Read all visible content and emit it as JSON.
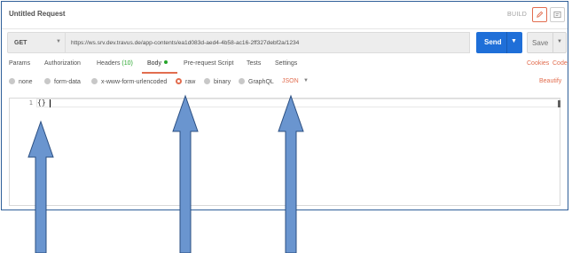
{
  "title": "Untitled Request",
  "build_label": "BUILD",
  "request": {
    "method": "GET",
    "url": "https://ws.srv.dev.travus.de/app-contents/ea1d083d-aed4-4b58-ac16-2ff327debf2a/1234",
    "send_label": "Send",
    "save_label": "Save"
  },
  "tabs": [
    {
      "label": "Params"
    },
    {
      "label": "Authorization"
    },
    {
      "label": "Headers",
      "count": "(10)"
    },
    {
      "label": "Body",
      "active": true
    },
    {
      "label": "Pre-request Script"
    },
    {
      "label": "Tests"
    },
    {
      "label": "Settings"
    }
  ],
  "tab_links": {
    "cookies": "Cookies",
    "code": "Code"
  },
  "body_modes": [
    {
      "label": "none"
    },
    {
      "label": "form-data"
    },
    {
      "label": "x-www-form-urlencoded"
    },
    {
      "label": "raw",
      "selected": true
    },
    {
      "label": "binary"
    },
    {
      "label": "GraphQL"
    }
  ],
  "raw_format": "JSON",
  "beautify_label": "Beautify",
  "editor": {
    "line_numbers": [
      "1"
    ],
    "code": "{}"
  },
  "colors": {
    "accent": "#e26d4f",
    "send": "#1f6fd8",
    "arrow_fill": "#6a95cf",
    "arrow_stroke": "#2b4f82"
  },
  "annotations": {
    "arrows_pointing_to": [
      "editor-code",
      "raw-radio",
      "json-format-select"
    ]
  }
}
